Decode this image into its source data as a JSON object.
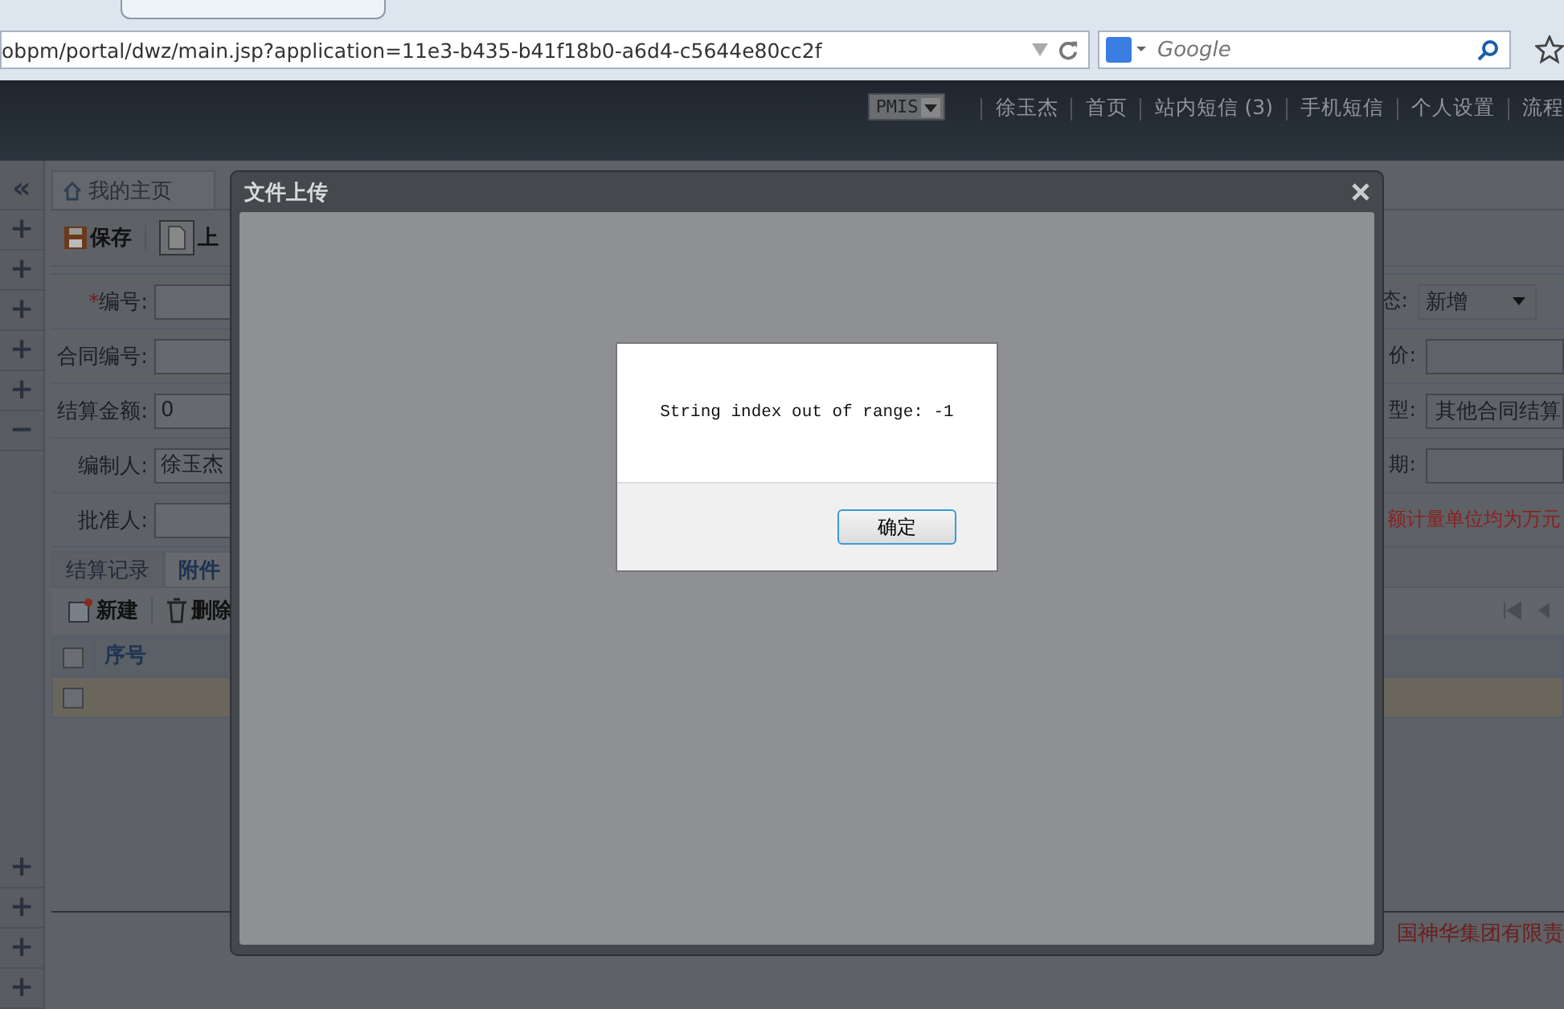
{
  "browser": {
    "address": "obpm/portal/dwz/main.jsp?application=11e3-b435-b41f18b0-a6d4-c5644e80cc2f",
    "search": {
      "placeholder": "Google"
    }
  },
  "header": {
    "system_select": "PMIS",
    "links": [
      "徐玉杰",
      "首页",
      "站内短信 (3)",
      "手机短信",
      "个人设置",
      "流程"
    ]
  },
  "sidebar": {
    "collapse": "«",
    "top_buttons": [
      "+",
      "+",
      "+",
      "+",
      "+",
      "−"
    ],
    "bottom_buttons": [
      "+",
      "+",
      "+",
      "+"
    ]
  },
  "page_tabs": [
    {
      "label": "我的主页"
    }
  ],
  "toolbar": [
    {
      "label": "保存",
      "kind": "save"
    },
    {
      "label": "上",
      "kind": "report"
    }
  ],
  "form": {
    "left": [
      {
        "marker": "*",
        "label": "编号:"
      },
      {
        "label": "合同编号:"
      },
      {
        "label": "结算金额:",
        "value": "0"
      },
      {
        "label": "编制人:",
        "value": "徐玉杰"
      },
      {
        "label": "批准人:"
      }
    ],
    "right": [
      {
        "label": "态:",
        "kind": "select",
        "value": "新增"
      },
      {
        "label": "价:",
        "kind": "input"
      },
      {
        "label": "型:",
        "kind": "input",
        "value": "其他合同结算"
      },
      {
        "label": "期:",
        "kind": "input"
      }
    ],
    "note": "额计量单位均为万元"
  },
  "detail_tabs": [
    {
      "label": "结算记录",
      "selected": false
    },
    {
      "label": "附件",
      "selected": true
    }
  ],
  "detail_toolbar": [
    {
      "label": "新建",
      "kind": "new"
    },
    {
      "label": "删除",
      "kind": "delete"
    }
  ],
  "grid": {
    "header_checked": false,
    "columns": [
      "序号"
    ],
    "rows": [
      {
        "checked": false,
        "selected": true
      }
    ]
  },
  "footer": "国神华集团有限责",
  "dialog": {
    "title": "文件上传",
    "alert": {
      "message": "String index out of range: -1",
      "button": "确定"
    }
  }
}
